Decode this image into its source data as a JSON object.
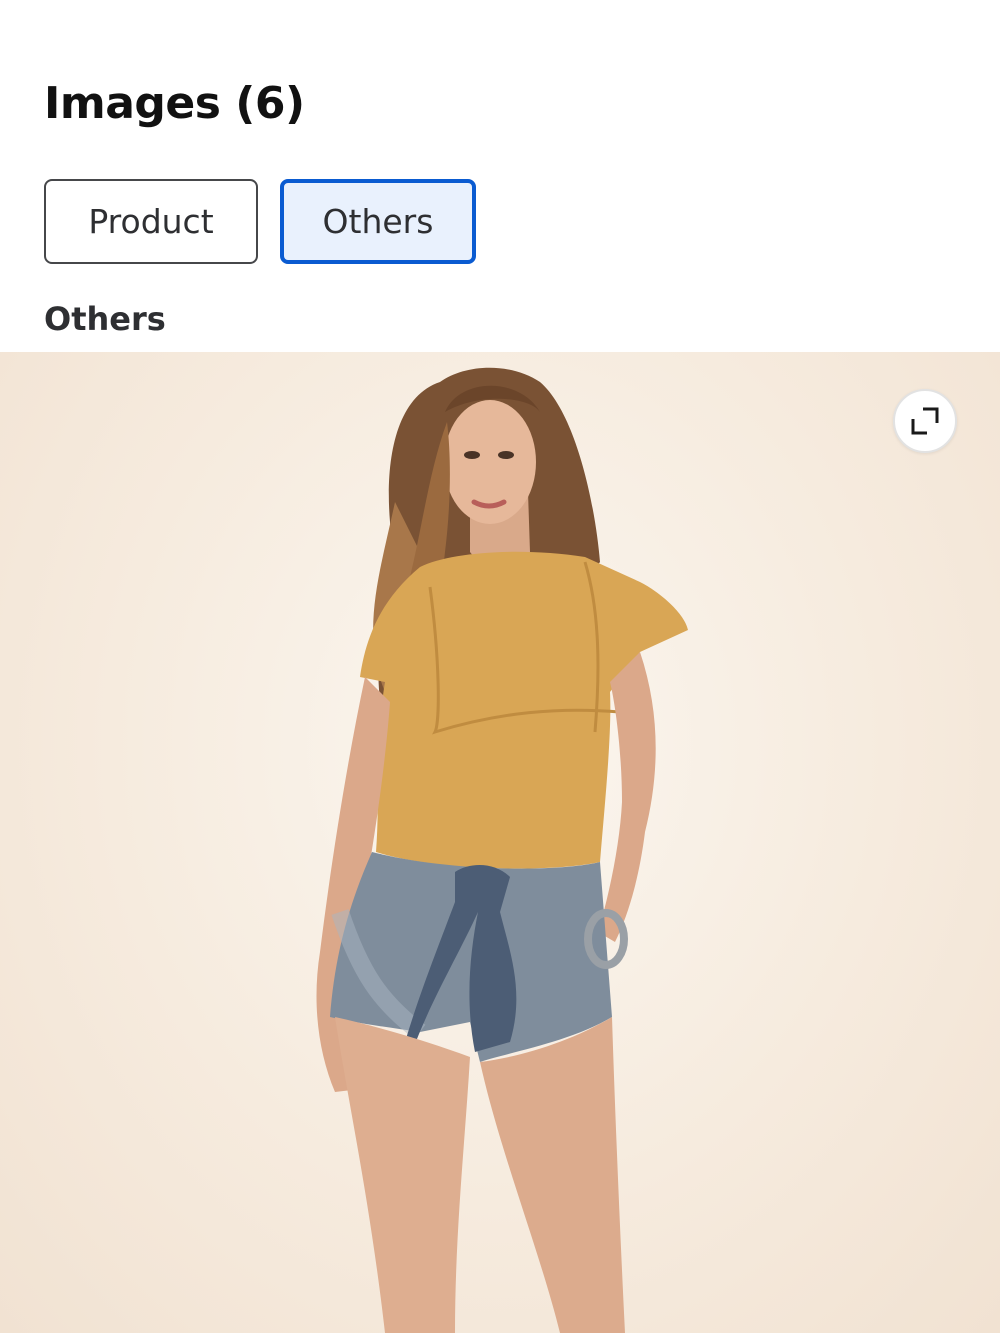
{
  "header": {
    "title": "Images (6)"
  },
  "tabs": [
    {
      "label": "Product",
      "selected": false
    },
    {
      "label": "Others",
      "selected": true
    }
  ],
  "section": {
    "title": "Others"
  },
  "image": {
    "description_icon": "expand-icon"
  },
  "colors": {
    "accent": "#0a5bd1",
    "selected_tab_bg": "#e9f1fd",
    "tab_border": "#46474a"
  }
}
